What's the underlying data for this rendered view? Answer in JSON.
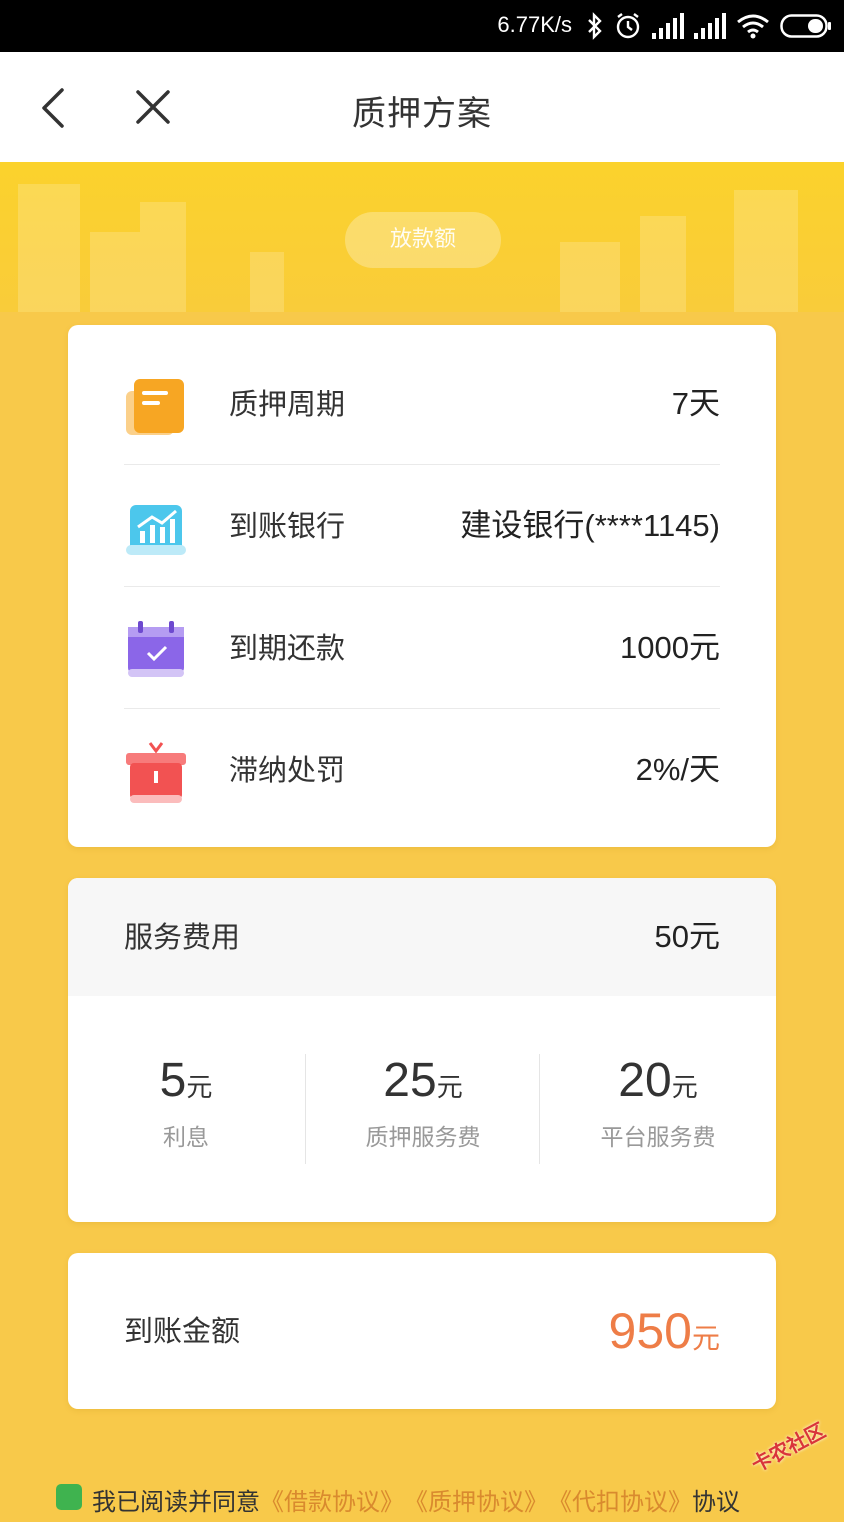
{
  "status_bar": {
    "speed": "6.77K/s",
    "icons": [
      "bluetooth-icon",
      "alarm-icon",
      "signal-icon",
      "signal-icon",
      "wifi-icon",
      "battery-icon"
    ]
  },
  "nav": {
    "title": "质押方案",
    "back_icon": "chevron-left-icon",
    "close_icon": "close-icon"
  },
  "hero": {
    "pill_label": "放款额"
  },
  "info": {
    "rows": [
      {
        "label": "质押周期",
        "value": "7天",
        "icon": "document-icon",
        "color": "#f7a623"
      },
      {
        "label": "到账银行",
        "value": "建设银行(****1145)",
        "icon": "chart-icon",
        "color": "#4cc7ec"
      },
      {
        "label": "到期还款",
        "value": "1000元",
        "icon": "calendar-check-icon",
        "color": "#8b66e8"
      },
      {
        "label": "滞纳处罚",
        "value": "2%/天",
        "icon": "gift-box-icon",
        "color": "#f25252"
      }
    ]
  },
  "fee": {
    "label": "服务费用",
    "value": "50元",
    "items": [
      {
        "amount": "5",
        "unit": "元",
        "caption": "利息"
      },
      {
        "amount": "25",
        "unit": "元",
        "caption": "质押服务费"
      },
      {
        "amount": "20",
        "unit": "元",
        "caption": "平台服务费"
      }
    ]
  },
  "total": {
    "label": "到账金额",
    "amount": "950",
    "unit": "元"
  },
  "agreement": {
    "prefix": "我已阅读并同意",
    "links": [
      "《借款协议》",
      "《质押协议》",
      "《代扣协议》"
    ],
    "suffix": "协议"
  },
  "watermark": {
    "text": "卡农社区"
  },
  "colors": {
    "background": "#f8c94a",
    "accent_orange": "#ee7d47",
    "link": "#d98a2e",
    "check_green": "#3fb34f"
  }
}
